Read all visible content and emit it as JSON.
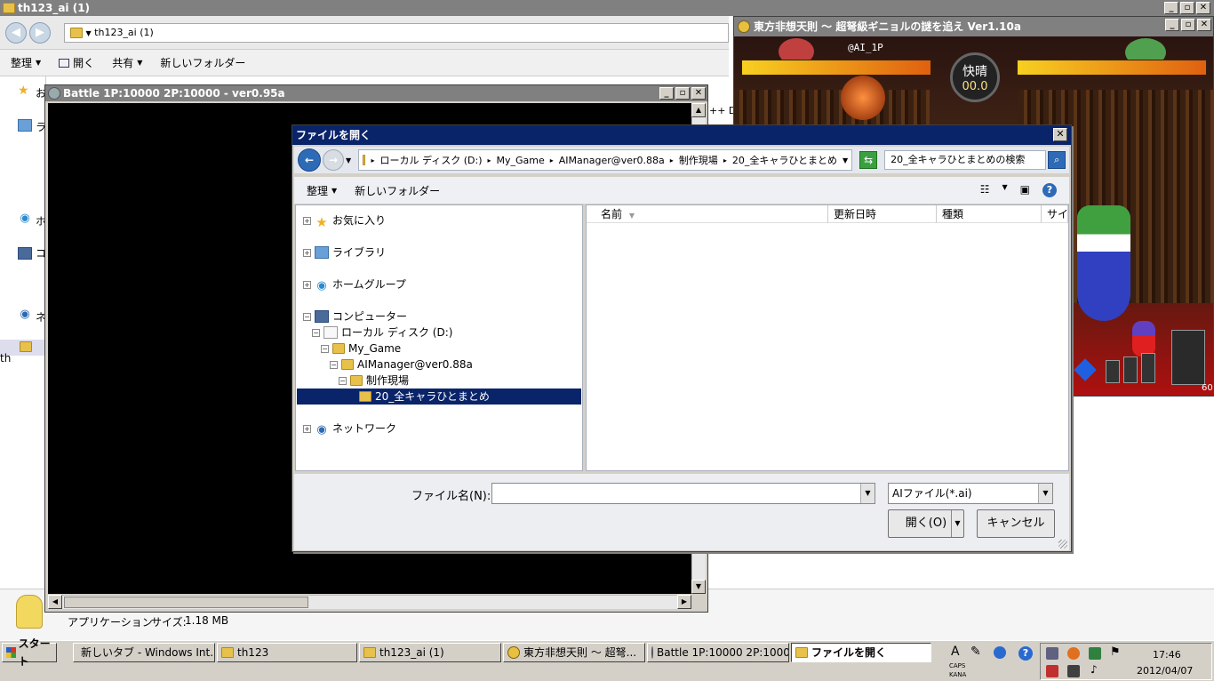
{
  "explorer": {
    "title": "th123_ai (1)",
    "address": "th123_ai (1)",
    "toolbar": {
      "organize": "整理",
      "open": "開く",
      "share": "共有",
      "new_folder": "新しいフォルダー"
    },
    "left_partial": [
      "お",
      "ラ",
      "ホ",
      "コ",
      "ネ",
      "th"
    ],
    "list_partial": "++ Do",
    "details": {
      "kind": "アプリケーション",
      "size_label": "サイズ:",
      "size": "1.18 MB"
    }
  },
  "game": {
    "title": "東方非想天則 ～ 超弩級ギニョルの謎を追え Ver1.10a",
    "player_tag": "@AI_1P",
    "weather_name": "快晴",
    "weather_value": "00.0",
    "fps": "60"
  },
  "battle": {
    "title": "Battle 1P:10000 2P:10000 - ver0.95a"
  },
  "dialog": {
    "title": "ファイルを開く",
    "path": [
      "ローカル ディスク (D:)",
      "My_Game",
      "AIManager@ver0.88a",
      "制作現場",
      "20_全キャラひとまとめ"
    ],
    "search_placeholder": "20_全キャラひとまとめの検索",
    "organize": "整理",
    "new_folder": "新しいフォルダー",
    "tree": {
      "favorites": "お気に入り",
      "libraries": "ライブラリ",
      "homegroup": "ホームグループ",
      "computer": "コンピューター",
      "local_disk": "ローカル ディスク (D:)",
      "my_game": "My_Game",
      "aimanager": "AIManager@ver0.88a",
      "workshop": "制作現場",
      "selected": "20_全キャラひとまとめ",
      "network": "ネットワーク"
    },
    "columns": {
      "name": "名前",
      "modified": "更新日時",
      "type": "種類",
      "size": "サイズ"
    },
    "filename_label": "ファイル名(N):",
    "filename_value": "",
    "filetype": "AIファイル(*.ai)",
    "open_button": "開く(O)",
    "cancel_button": "キャンセル"
  },
  "taskbar": {
    "start": "スタート",
    "tasks": [
      "新しいタブ - Windows Int...",
      "th123",
      "th123_ai (1)",
      "東方非想天則 ～ 超弩...",
      "Battle 1P:10000 2P:1000...",
      "ファイルを開く"
    ],
    "ime": {
      "a": "A",
      "caps": "CAPS",
      "kana": "KANA"
    },
    "time": "17:46",
    "date": "2012/04/07"
  },
  "colors": {
    "dialog_title": "#0a246a",
    "selection": "#0a246a",
    "hp_bar": "#f8d020"
  }
}
